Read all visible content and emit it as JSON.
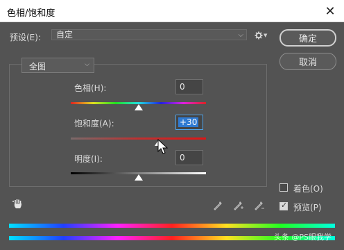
{
  "window": {
    "title": "色相/饱和度",
    "close_glyph": "✕"
  },
  "preset": {
    "label": "预设(E):",
    "value": "自定",
    "chevron": "⌵"
  },
  "buttons": {
    "ok": "确定",
    "cancel": "取消"
  },
  "range": {
    "value": "全图",
    "chevron": "⌵"
  },
  "sliders": {
    "hue": {
      "label": "色相(H):",
      "value": "0",
      "position": 0.5
    },
    "saturation": {
      "label": "饱和度(A):",
      "value": "+30",
      "position": 0.65
    },
    "lightness": {
      "label": "明度(I):",
      "value": "0",
      "position": 0.5
    }
  },
  "options": {
    "colorize": {
      "label": "着色(O)",
      "checked": false
    },
    "preview": {
      "label": "预览(P)",
      "checked": true
    }
  },
  "watermark": "头条 @PS眼我学",
  "icons": [
    "close-icon",
    "chevron-down-icon",
    "gear-icon",
    "hand-adjust-icon",
    "eyedropper-icon",
    "eyedropper-plus-icon",
    "eyedropper-minus-icon",
    "mouse-cursor-icon"
  ]
}
